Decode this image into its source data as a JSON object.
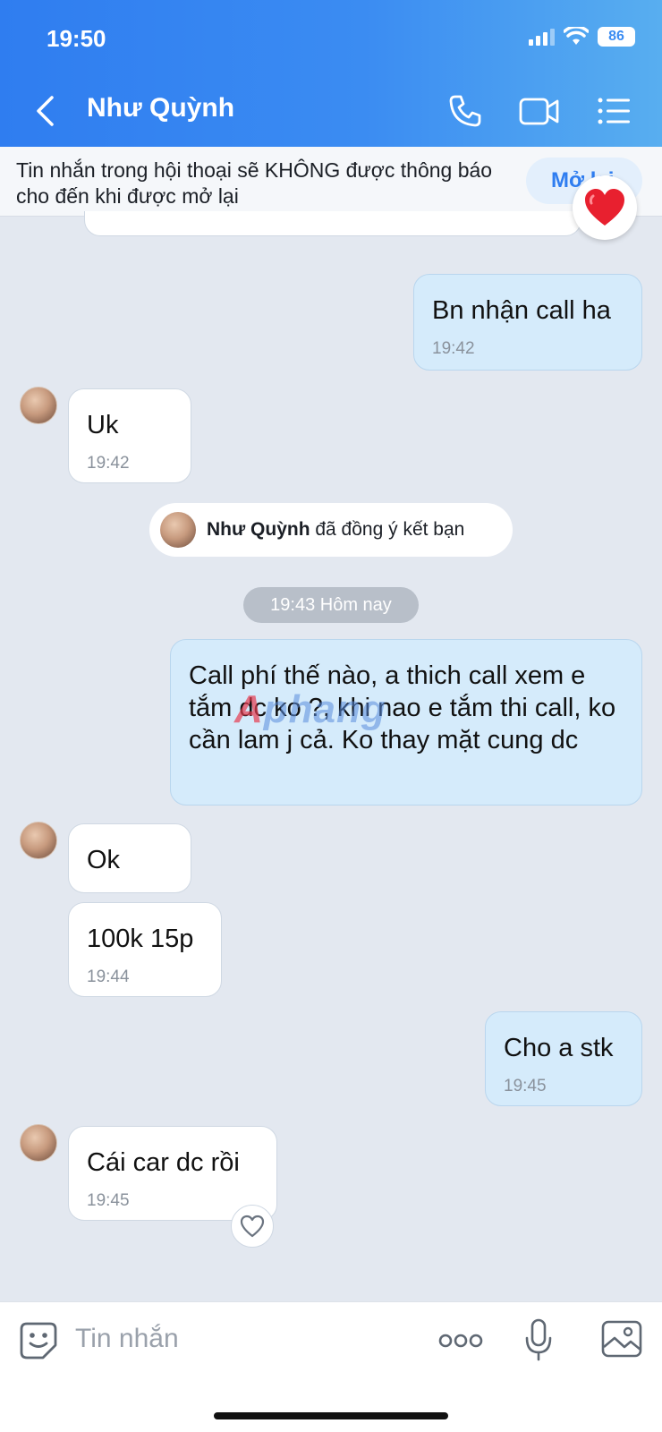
{
  "status": {
    "time": "19:50",
    "battery": "86"
  },
  "header": {
    "contact_name": "Như Quỳnh"
  },
  "notice": {
    "text": "Tin nhắn trong hội thoại sẽ KHÔNG được thông báo cho đến khi được mở lại",
    "button": "Mở lại"
  },
  "messages": [
    {
      "dir": "out",
      "text": "Bn nhận call ha",
      "time": "19:42"
    },
    {
      "dir": "in",
      "text": "Uk",
      "time": "19:42"
    },
    {
      "dir": "out",
      "text": "Call phí thế nào, a thich call xem e tắm dc ko ?, khi nao e tắm thi call, ko cần lam j cả. Ko thay mặt cung dc",
      "time": ""
    },
    {
      "dir": "in",
      "text": "Ok",
      "time": ""
    },
    {
      "dir": "in",
      "text": "100k 15p",
      "time": "19:44"
    },
    {
      "dir": "out",
      "text": "Cho a stk",
      "time": "19:45"
    },
    {
      "dir": "in",
      "text": "Cái car dc rồi",
      "time": "19:45"
    }
  ],
  "system": {
    "name": "Như Quỳnh",
    "action": " đã đồng ý kết bạn"
  },
  "date_separator": "19:43 Hôm nay",
  "watermark": {
    "a": "A",
    "rest": "phang"
  },
  "input": {
    "placeholder": "Tin nhắn"
  },
  "colors": {
    "header_start": "#2f7df0",
    "header_end": "#58aef0",
    "out_bubble": "#d5ebfb",
    "accent": "#2f7df0"
  }
}
